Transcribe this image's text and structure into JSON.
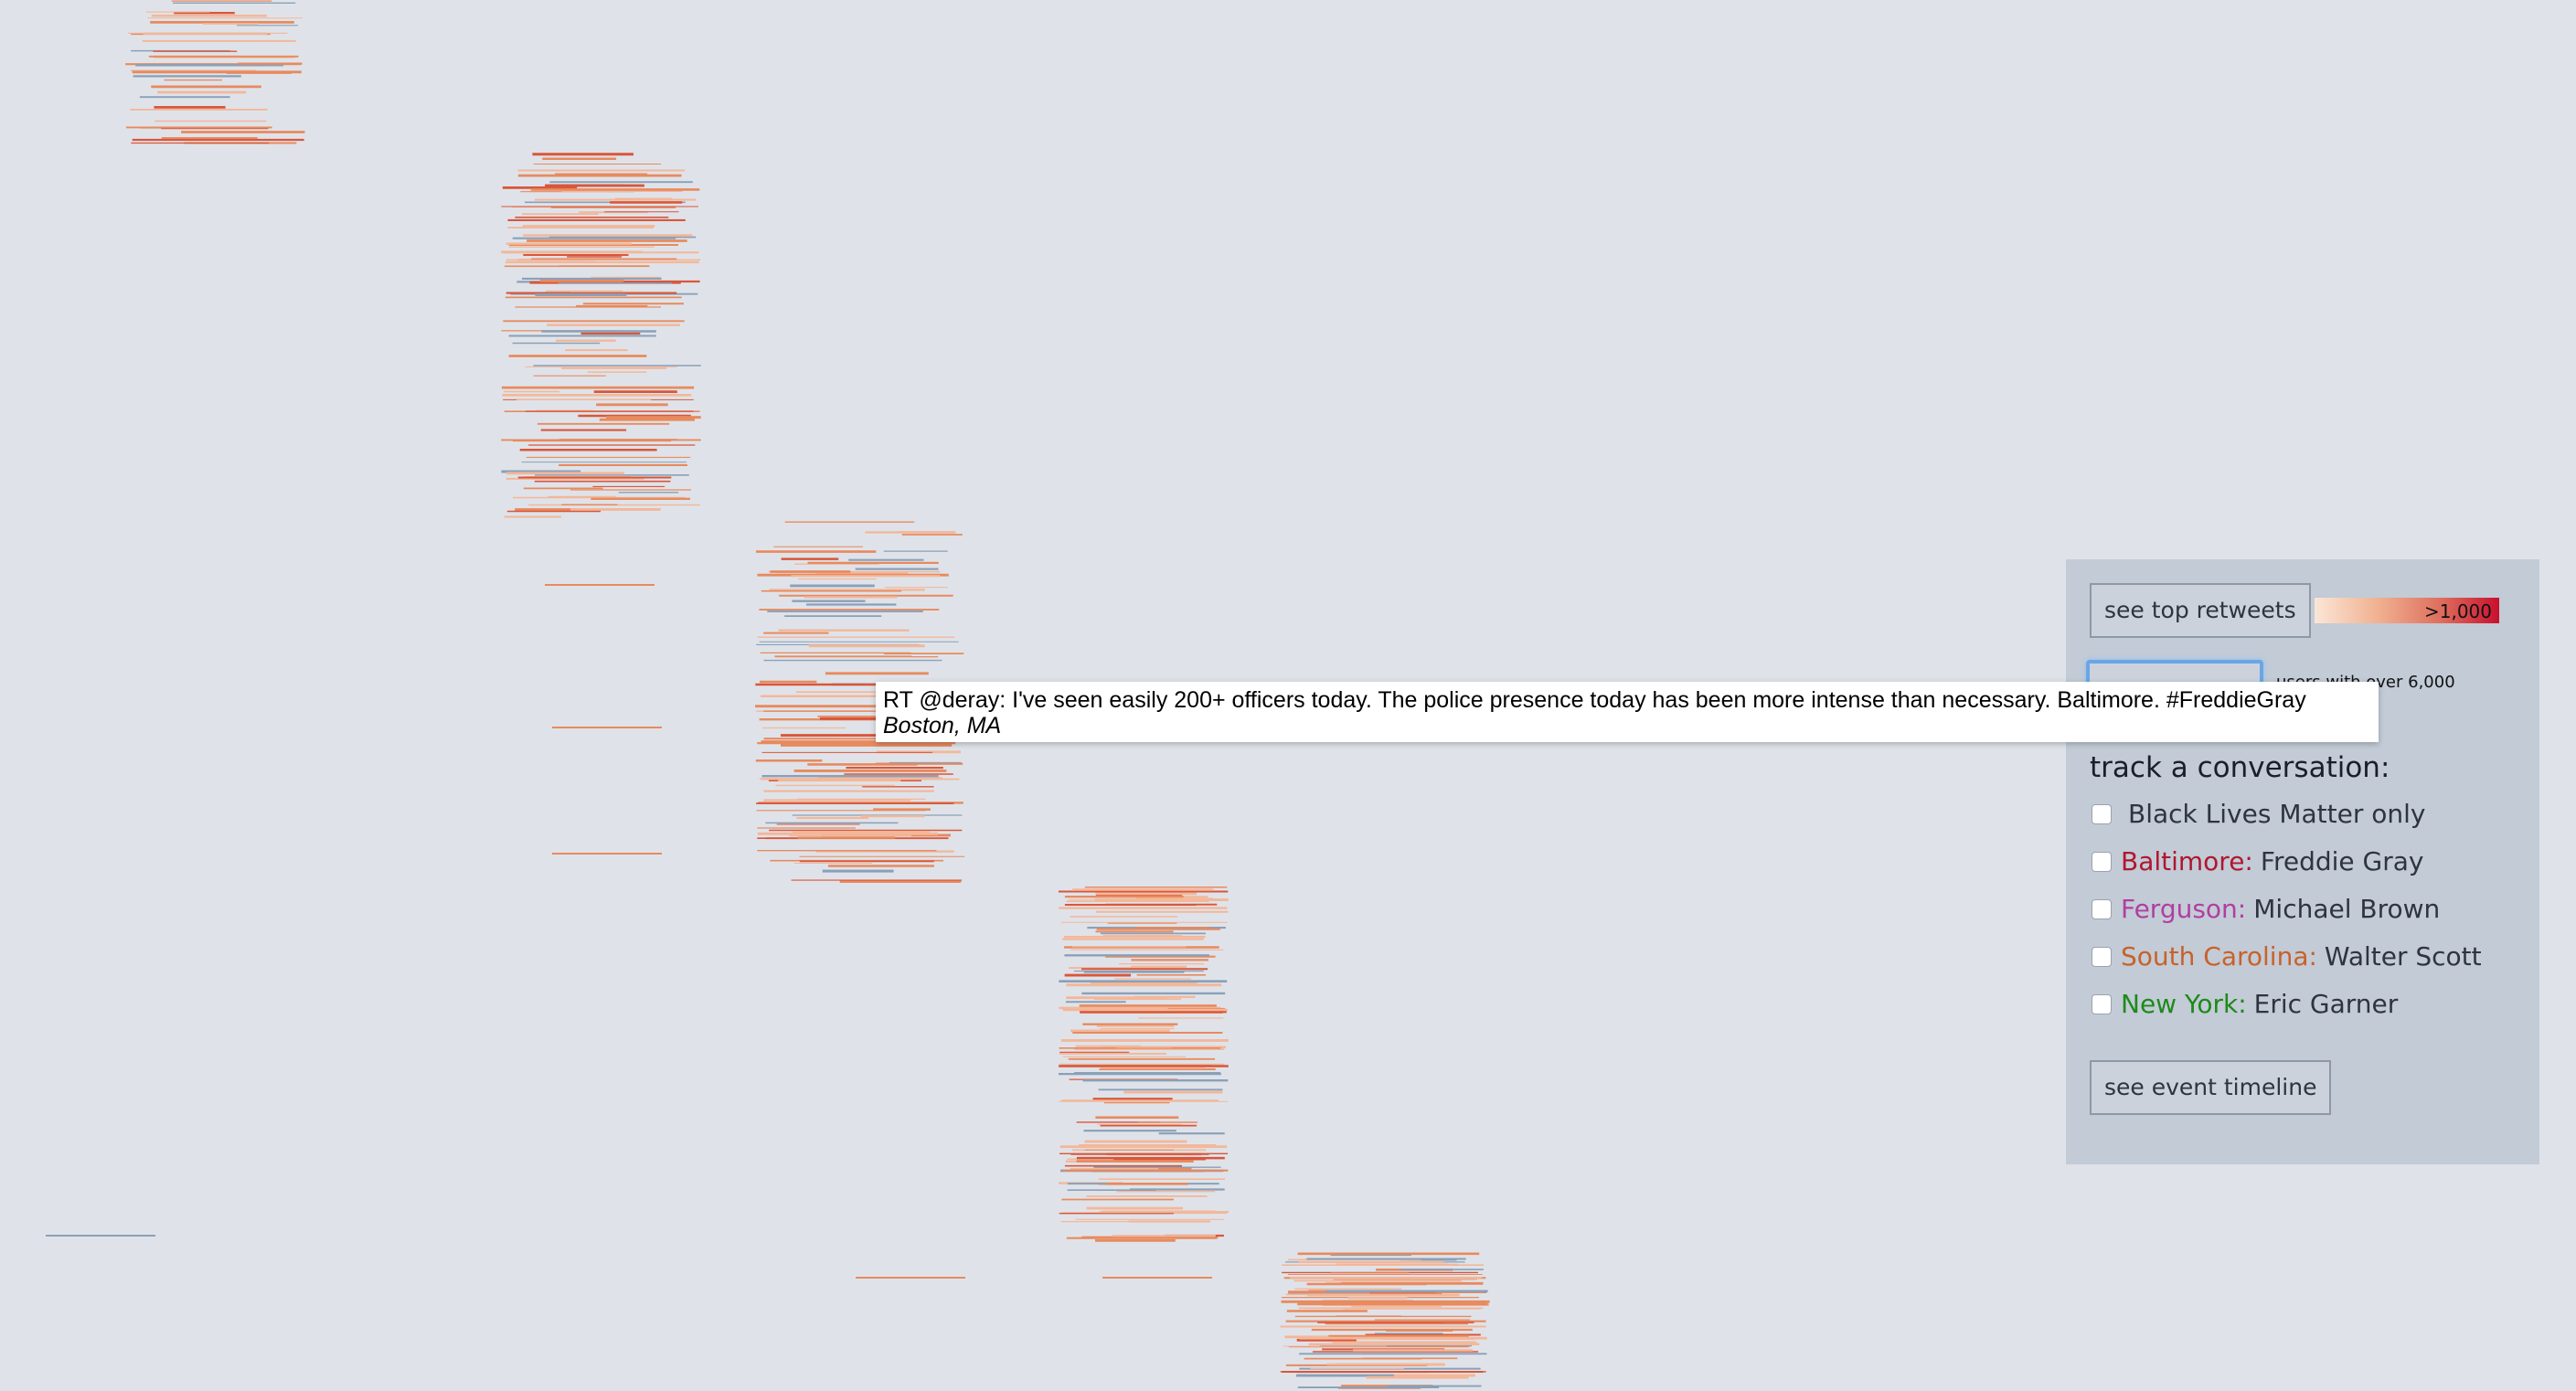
{
  "panel": {
    "top_retweets_label": "see top retweets",
    "legend_max_label": ">1,000",
    "users_note": "users with over 6,000",
    "track_title": "track a conversation:",
    "options": [
      {
        "place": "",
        "place_color": "#2e3440",
        "name": "Black Lives Matter only"
      },
      {
        "place": "Baltimore:",
        "place_color": "#b0172f",
        "name": "Freddie Gray"
      },
      {
        "place": "Ferguson:",
        "place_color": "#b23ea0",
        "name": "Michael Brown"
      },
      {
        "place": "South Carolina:",
        "place_color": "#c8612a",
        "name": "Walter Scott"
      },
      {
        "place": "New York:",
        "place_color": "#1e8a1a",
        "name": "Eric Garner"
      }
    ],
    "timeline_label": "see event timeline"
  },
  "tooltip": {
    "text": "RT @deray: I've seen easily 200+ officers today. The police presence today has been more intense than necessary. Baltimore. #FreddieGray",
    "location": "Boston, MA"
  },
  "colors": {
    "background": "#dfe3e9",
    "line_light": "#f3b79a",
    "line_mid": "#e88a5e",
    "line_dark": "#d9563a",
    "line_blue": "#8aa0b8"
  }
}
